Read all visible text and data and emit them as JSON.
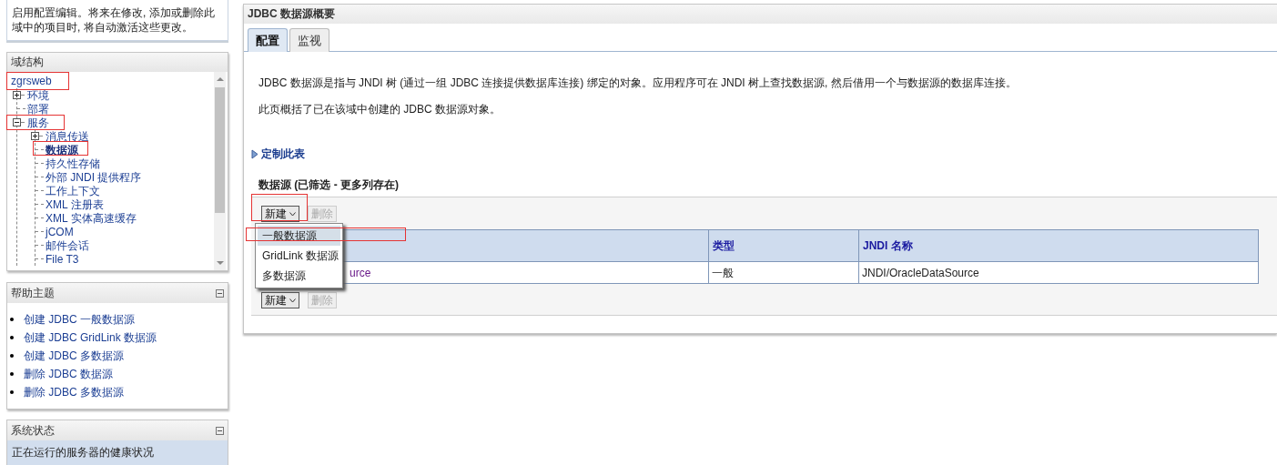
{
  "notice": "启用配置编辑。将来在修改, 添加或删除此域中的项目时, 将自动激活这些更改。",
  "domain_structure": {
    "title": "域结构",
    "tree": [
      {
        "label": "zgrsweb",
        "selected": false,
        "children": [
          {
            "label": "环境",
            "expanded": false,
            "selected": false
          },
          {
            "label": "部署",
            "selected": false
          },
          {
            "label": "服务",
            "expanded": true,
            "selected": false,
            "children": [
              {
                "label": "消息传送",
                "expanded": false,
                "selected": false
              },
              {
                "label": "数据源",
                "selected": true
              },
              {
                "label": "持久性存储",
                "selected": false
              },
              {
                "label": "外部 JNDI 提供程序",
                "selected": false
              },
              {
                "label": "工作上下文",
                "selected": false
              },
              {
                "label": "XML 注册表",
                "selected": false
              },
              {
                "label": "XML 实体高速缓存",
                "selected": false
              },
              {
                "label": "jCOM",
                "selected": false
              },
              {
                "label": "邮件会话",
                "selected": false
              },
              {
                "label": "File T3",
                "selected": false
              }
            ]
          }
        ]
      }
    ]
  },
  "help_topics": {
    "title": "帮助主题",
    "links": [
      "创建 JDBC 一般数据源",
      "创建 JDBC GridLink 数据源",
      "创建 JDBC 多数据源",
      "删除 JDBC 数据源",
      "删除 JDBC 多数据源"
    ]
  },
  "system_status": {
    "title": "系统状态",
    "text": "正在运行的服务器的健康状况"
  },
  "main": {
    "title": "JDBC 数据源概要",
    "tabs": [
      {
        "label": "配置",
        "selected": true
      },
      {
        "label": "监视",
        "selected": false
      }
    ],
    "paragraphs": [
      "JDBC 数据源是指与 JNDI 树 (通过一组 JDBC 连接提供数据库连接) 绑定的对象。应用程序可在 JNDI 树上查找数据源, 然后借用一个与数据源的数据库连接。",
      "此页概括了已在该域中创建的 JDBC 数据源对象。"
    ],
    "customize_link": "定制此表",
    "table_title": "数据源 (已筛选 - 更多列存在)",
    "top_buttons": [
      {
        "label": "新建",
        "kind": "menu",
        "disabled": false
      },
      {
        "label": "删除",
        "kind": "plain",
        "disabled": true
      }
    ],
    "bottom_buttons": [
      {
        "label": "新建",
        "kind": "menu",
        "disabled": false
      },
      {
        "label": "删除",
        "kind": "plain",
        "disabled": true
      }
    ],
    "table": {
      "columns": [
        "类型",
        "JNDI 名称"
      ],
      "rows": [
        {
          "column_1": "urce",
          "type": "一般",
          "jndi_name": "JNDI/OracleDataSource"
        }
      ]
    },
    "dropdown_menu": [
      {
        "label": "一般数据源",
        "selected": true
      },
      {
        "label": "GridLink 数据源",
        "selected": false
      },
      {
        "label": "多数据源",
        "selected": false
      }
    ]
  }
}
